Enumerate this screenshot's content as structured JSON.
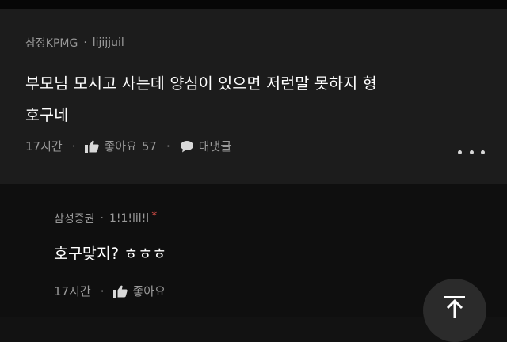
{
  "comment": {
    "author": "삼정KPMG",
    "author_id": "lijijjuil",
    "text_line1": "부모님 모시고 사는데 양심이 있으면 저런말 못하지 형",
    "text_line2": "호구네",
    "time": "17시간",
    "like_label": "좋아요",
    "like_count": "57",
    "reply_label": "대댓글"
  },
  "reply": {
    "author": "삼성증권",
    "author_id": "1!1!lil!l",
    "required_mark": "*",
    "text": "호구맞지? ㅎㅎㅎ",
    "time": "17시간",
    "like_label": "좋아요"
  },
  "separators": {
    "meta": "·",
    "action": "·"
  },
  "icons": {
    "like": "thumbs-up-icon",
    "reply": "speech-bubble-icon",
    "more": "more-dots-icon",
    "scroll_top": "arrow-to-top-icon"
  },
  "colors": {
    "card_bg": "#1c1c1c",
    "page_bg": "#0f0f0f",
    "meta_text": "#9a9a9a",
    "body_text": "#ffffff",
    "required_mark": "#e0524b"
  }
}
